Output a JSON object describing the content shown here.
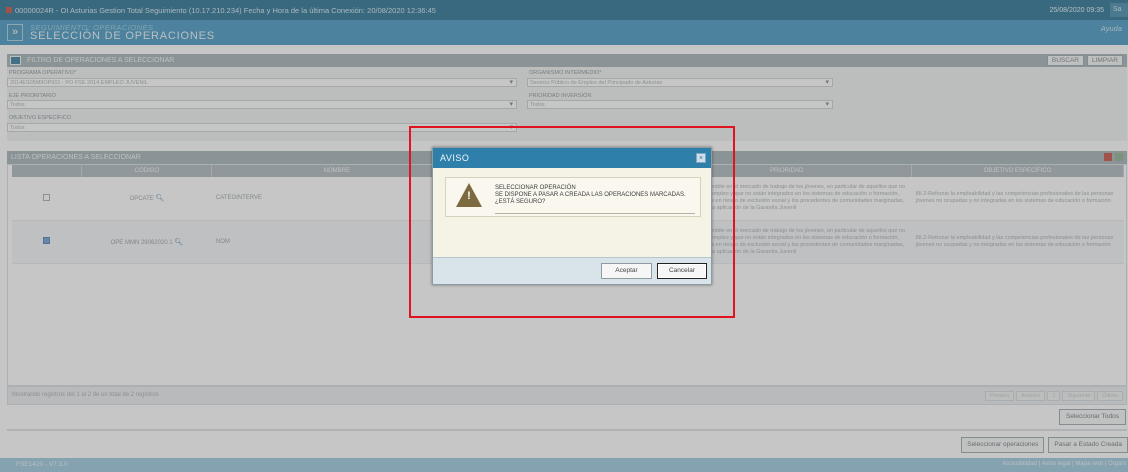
{
  "topbar": {
    "title": "00000024R - OI Asturias Gestion Total Seguimiento (10.17.210.234) Fecha y Hora de la última Conexión: 20/08/2020 12:36:45",
    "date": "25/08/2020 09:35",
    "exit_label": "Sa"
  },
  "header": {
    "nav_glyph": "»",
    "subtitle": "SEGUIMIENTO: OPERACIONES",
    "title": "SELECCIÓN DE OPERACIONES",
    "help": "Ayuda"
  },
  "filter": {
    "heading": "FILTRO DE OPERACIONES A SELECCIONAR",
    "search_label": "BUSCAR",
    "clear_label": "LIMPIAR",
    "programa_label": "PROGRAMA OPERATIVO*",
    "programa_value": "2014ES05M9OP001 - PO FSE 2014 EMPLEO JUVENIL",
    "organismo_label": "ORGANISMO INTERMEDIO*",
    "organismo_value": "Servicio Público de Empleo del Principado de Asturias",
    "eje_label": "EJE PRIORITARIO",
    "eje_value": "Todos",
    "prioridad_label": "PRIORIDAD INVERSIÓN",
    "prioridad_value": "Todos",
    "objetivo_label": "OBJETIVO ESPECÍFICO",
    "objetivo_value": "Todos"
  },
  "list": {
    "heading": "LISTA OPERACIONES A SELECCIONAR",
    "columns": [
      "",
      "CÓDIGO",
      "NOMBRE",
      "",
      "PRIORIDAD",
      "OBJETIVO ESPECÍFICO"
    ],
    "rows": [
      {
        "checked": false,
        "code": "OPCATE",
        "name": "CATEGINTERVE",
        "mid": "S",
        "priority": "la integración sostenible en el mercado de trabajo de los jóvenes, en particular de aquellos que no se encuentran sin empleo y que no están integrados en los sistemas de educación o formación, incluyendo aquellos en riesgo de exclusión social y los procedentes de comunidades marginadas, también mediante la aplicación de la Garantía Juvenil",
        "objective": "8II.2-Reforzar la empleabilidad y las competencias profesionales de las personas jóvenes no ocupadas y no integradas en los sistemas de educación o formación"
      },
      {
        "checked": true,
        "code": "OPE MMN 29062020 1",
        "name": "NOM",
        "mid": "S",
        "priority": "la integración sostenible en el mercado de trabajo de los jóvenes, en particular de aquellos que no se encuentran sin empleo y que no están integrados en los sistemas de educación o formación, incluyendo aquellos en riesgo de exclusión social y los procedentes de comunidades marginadas, también mediante la aplicación de la Garantía Juvenil",
        "objective": "8II.2-Reforzar la empleabilidad y las competencias profesionales de las personas jóvenes no ocupadas y no integradas en los sistemas de educación o formación"
      }
    ],
    "footer_info": "Mostrando registros del 1 al 2 de un total de 2 registros",
    "pager": [
      "Primero",
      "Anterior",
      "1",
      "Siguiente",
      "Último"
    ]
  },
  "actions": {
    "select_all": "Seleccionar Todos",
    "select_ops": "Seleccionar operaciones",
    "pass_state": "Pasar a Estado Creada"
  },
  "status": {
    "version": "FSE1420 - V7.3.0",
    "links": "Accesibilidad | Aviso legal | Mapa web | Organi"
  },
  "dialog": {
    "title": "AVISO",
    "close": "×",
    "line1": "SELECCIONAR OPERACIÓN",
    "line2": "SE DISPONE A PASAR A CREADA LAS OPERACIONES MARCADAS.",
    "line3": "¿ESTÁ SEGURO?",
    "accept": "Aceptar",
    "cancel": "Cancelar"
  },
  "colors": {
    "accent": "#2d8bb8",
    "highlight": "#e0141e"
  }
}
